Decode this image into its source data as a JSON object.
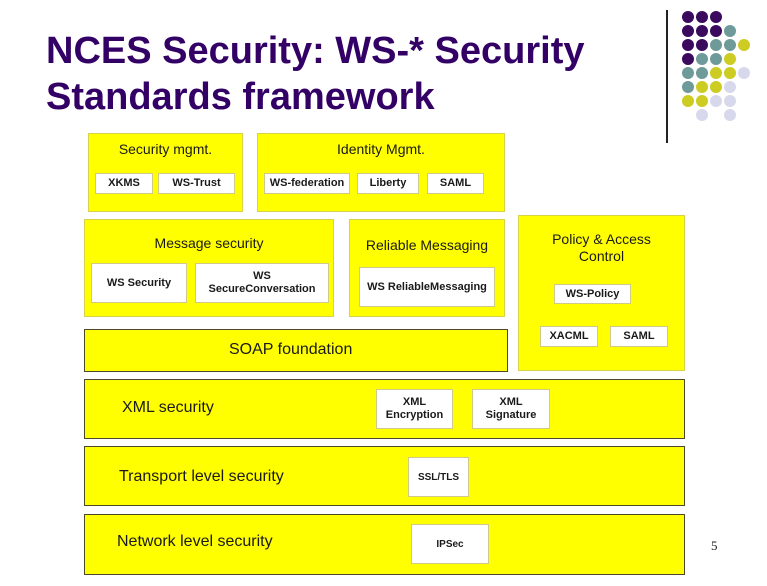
{
  "slide": {
    "title_line1": "NCES Security: WS-* Security",
    "title_line2": "Standards framework",
    "page_number": "5",
    "colors": {
      "title": "#330066",
      "box_fill": "#ffff00",
      "standard_fill": "#ffffff",
      "dot_purple": "#3b0a5e",
      "dot_teal": "#6e9a9a",
      "dot_olive": "#cccc22",
      "dot_lavender": "#d8d8ec"
    }
  },
  "decoration": {
    "dot_grid": [
      [
        "purple",
        "purple",
        "purple",
        "",
        "",
        ""
      ],
      [
        "purple",
        "purple",
        "purple",
        "teal",
        "",
        ""
      ],
      [
        "purple",
        "purple",
        "teal",
        "teal",
        "olive",
        ""
      ],
      [
        "purple",
        "teal",
        "teal",
        "olive",
        "",
        ""
      ],
      [
        "teal",
        "teal",
        "olive",
        "olive",
        "lavender",
        ""
      ],
      [
        "teal",
        "olive",
        "olive",
        "lavender",
        "",
        ""
      ],
      [
        "olive",
        "olive",
        "lavender",
        "lavender",
        "",
        ""
      ],
      [
        "",
        "lavender",
        "",
        "lavender",
        "",
        ""
      ]
    ]
  },
  "framework": {
    "security_mgmt": {
      "label": "Security mgmt.",
      "standards": [
        "XKMS",
        "WS-Trust"
      ]
    },
    "identity_mgmt": {
      "label": "Identity Mgmt.",
      "standards": [
        "WS-federation",
        "Liberty",
        "SAML"
      ]
    },
    "message_security": {
      "label": "Message security",
      "standards": [
        "WS Security",
        "WS\nSecureConversation"
      ]
    },
    "reliable_messaging": {
      "label": "Reliable Messaging",
      "standards": [
        "WS ReliableMessaging"
      ]
    },
    "policy_access": {
      "label": "Policy & Access\nControl",
      "standards": [
        "WS-Policy",
        "XACML",
        "SAML"
      ]
    },
    "soap_foundation": {
      "label": "SOAP foundation"
    },
    "xml_security": {
      "label": "XML security",
      "standards": [
        "XML\nEncryption",
        "XML\nSignature"
      ]
    },
    "transport_security": {
      "label": "Transport level security",
      "standards": [
        "SSL/TLS"
      ]
    },
    "network_security": {
      "label": "Network level security",
      "standards": [
        "IPSec"
      ]
    }
  }
}
